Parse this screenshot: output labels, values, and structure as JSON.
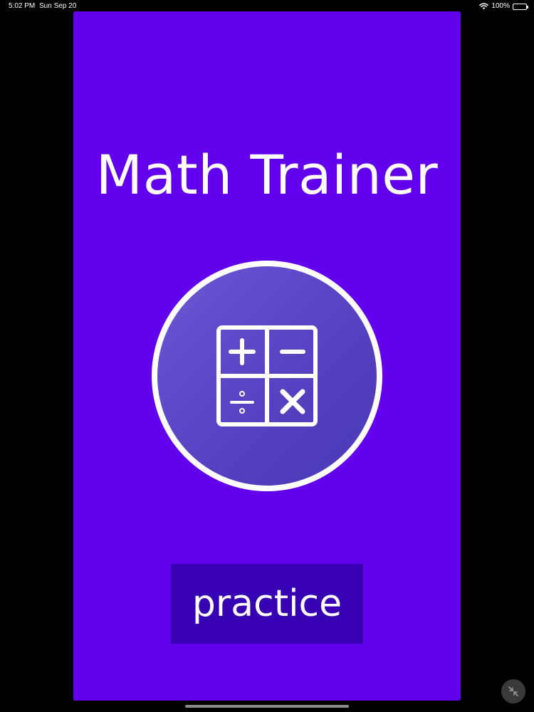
{
  "status_bar": {
    "time": "5:02 PM",
    "date": "Sun Sep 20",
    "battery": "100%",
    "wifi_icon": "wifi-icon",
    "battery_icon": "battery-icon"
  },
  "app": {
    "title": "Math Trainer",
    "logo_icon": "calculator-operations-icon",
    "practice_label": "practice"
  },
  "system": {
    "collapse_icon": "collapse-arrows-icon"
  },
  "colors": {
    "screen_background": "#000000",
    "app_background": "#6200ee",
    "button_background": "#3700b3",
    "text": "#ffffff"
  }
}
